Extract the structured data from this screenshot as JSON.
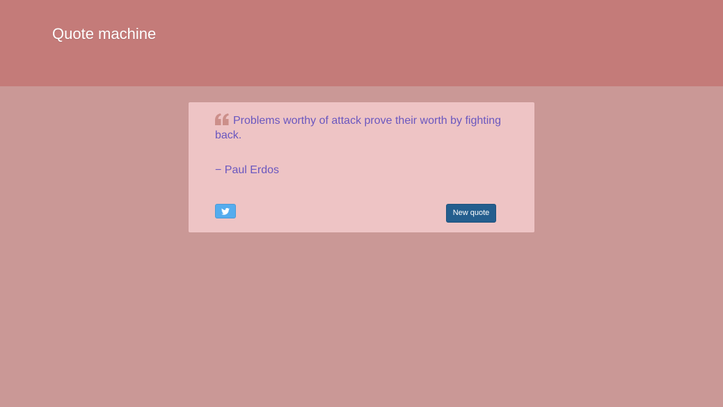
{
  "header": {
    "title": "Quote machine"
  },
  "quote": {
    "text": "Problems worthy of attack prove their worth by fighting back.",
    "author": "− Paul Erdos",
    "icon": "quote-left-icon"
  },
  "actions": {
    "tweet_icon": "twitter-icon",
    "new_quote_label": "New quote"
  },
  "colors": {
    "header_bg": "#c47b79",
    "page_bg": "#ca9896",
    "card_bg": "#eec4c5",
    "text": "#6a57bf",
    "tweet_button": "#55acee",
    "new_quote_button": "#245e8e"
  }
}
